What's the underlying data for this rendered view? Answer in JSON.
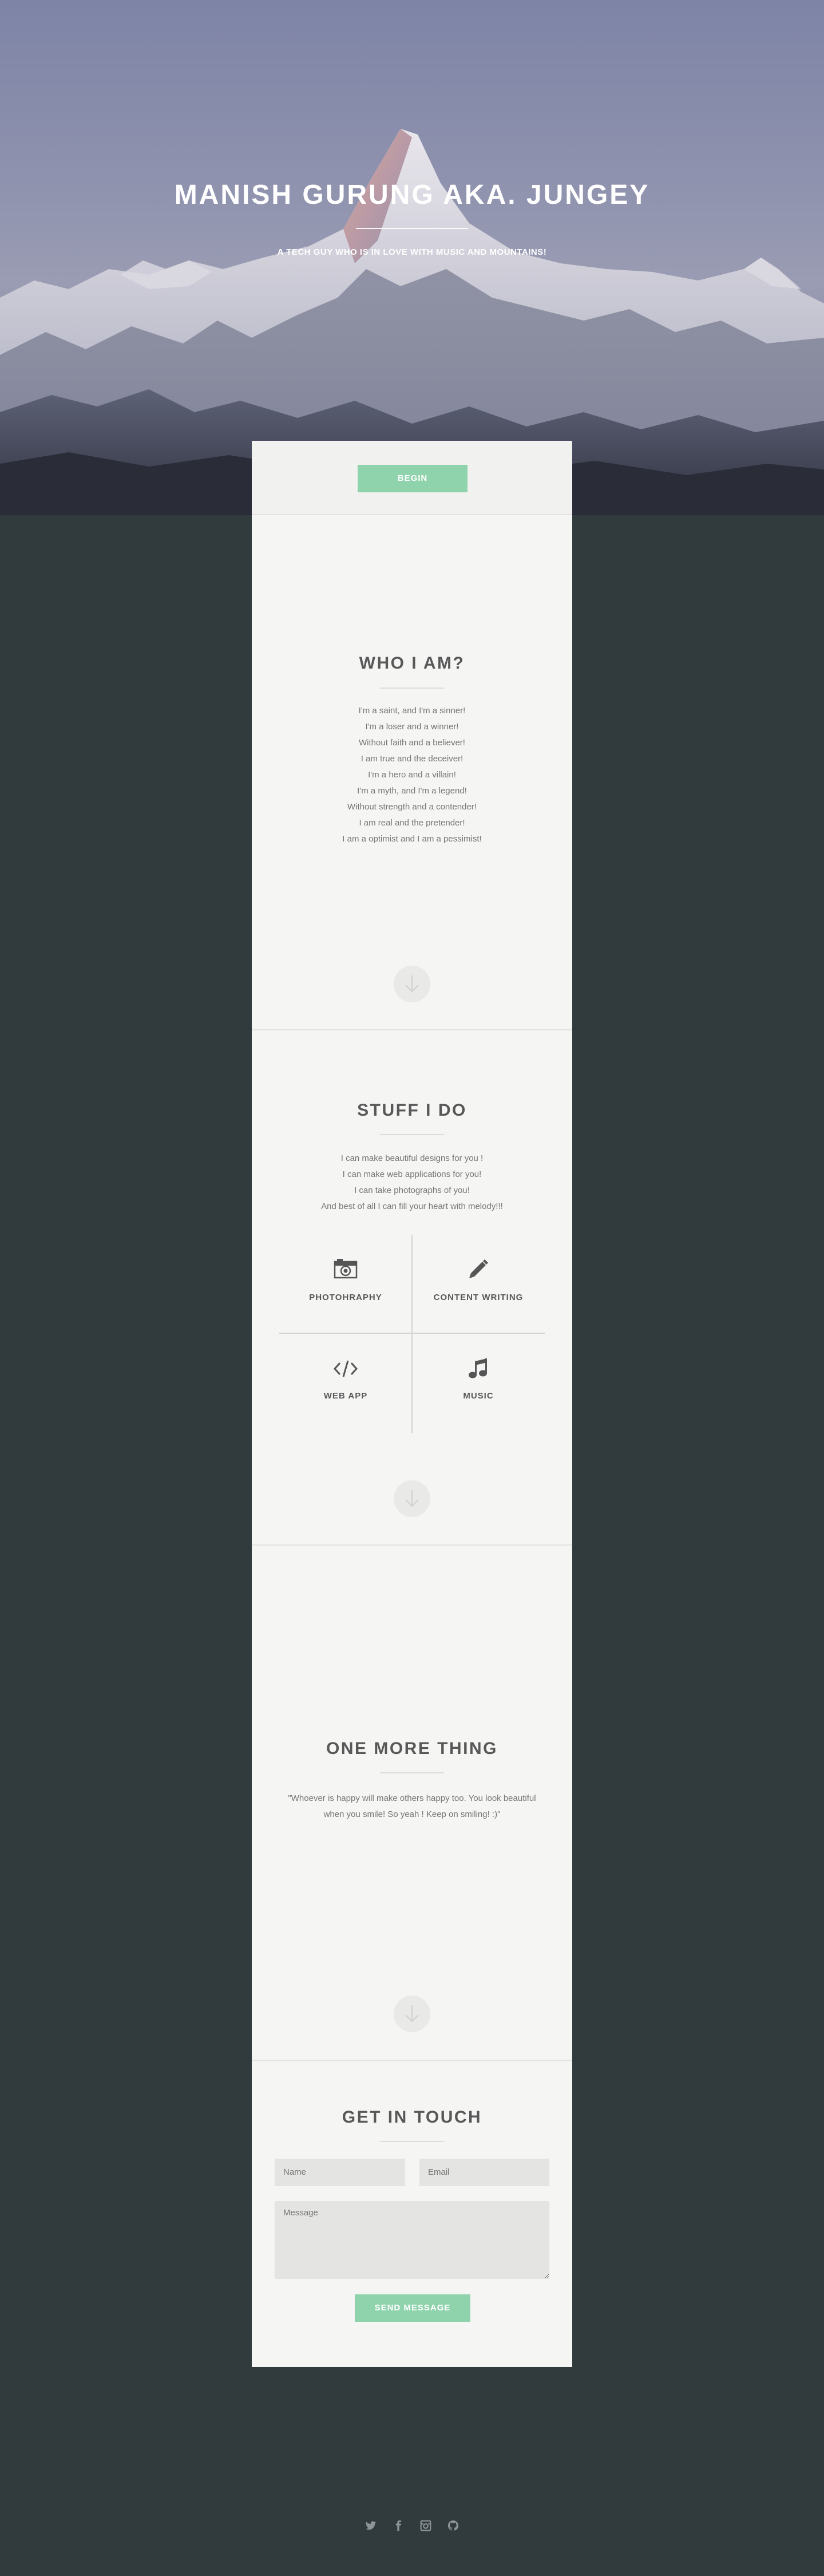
{
  "hero": {
    "title": "MANISH GURUNG AKA. JUNGEY",
    "subtitle": "A TECH GUY WHO IS IN LOVE WITH MUSIC AND MOUNTAINS!"
  },
  "begin": {
    "button_label": "BEGIN"
  },
  "who": {
    "title": "WHO I AM?",
    "lines": [
      "I'm a saint, and I'm a sinner!",
      "I'm a loser and a winner!",
      "Without faith and a believer!",
      "I am true and the deceiver!",
      "I'm a hero and a villain!",
      "I'm a myth, and I'm a legend!",
      "Without strength and a contender!",
      "I am real and the pretender!",
      "I am a optimist and I am a pessimist!"
    ]
  },
  "stuff": {
    "title": "STUFF I DO",
    "lines": [
      "I can make beautiful designs for you !",
      "I can make web applications for you!",
      "I can take photographs of you!",
      "And best of all I can fill your heart with melody!!!"
    ],
    "services": [
      {
        "label": "PHOTOHRAPHY",
        "icon": "camera-icon"
      },
      {
        "label": "CONTENT WRITING",
        "icon": "pencil-icon"
      },
      {
        "label": "WEB APP",
        "icon": "code-icon"
      },
      {
        "label": "MUSIC",
        "icon": "music-icon"
      }
    ]
  },
  "more": {
    "title": "ONE MORE THING",
    "lines": [
      "\"Whoever is happy will make others happy too. You look beautiful",
      "when you smile! So yeah ! Keep on smiling! :)\""
    ]
  },
  "contact": {
    "title": "GET IN TOUCH",
    "name_placeholder": "Name",
    "email_placeholder": "Email",
    "message_placeholder": "Message",
    "send_label": "SEND MESSAGE"
  },
  "social": [
    "twitter-icon",
    "facebook-icon",
    "instagram-icon",
    "github-icon"
  ],
  "colors": {
    "accent": "#8fd3ad",
    "background": "#313a3d",
    "panel": "#f5f5f4",
    "heading": "#585858",
    "body_text": "#757575"
  }
}
